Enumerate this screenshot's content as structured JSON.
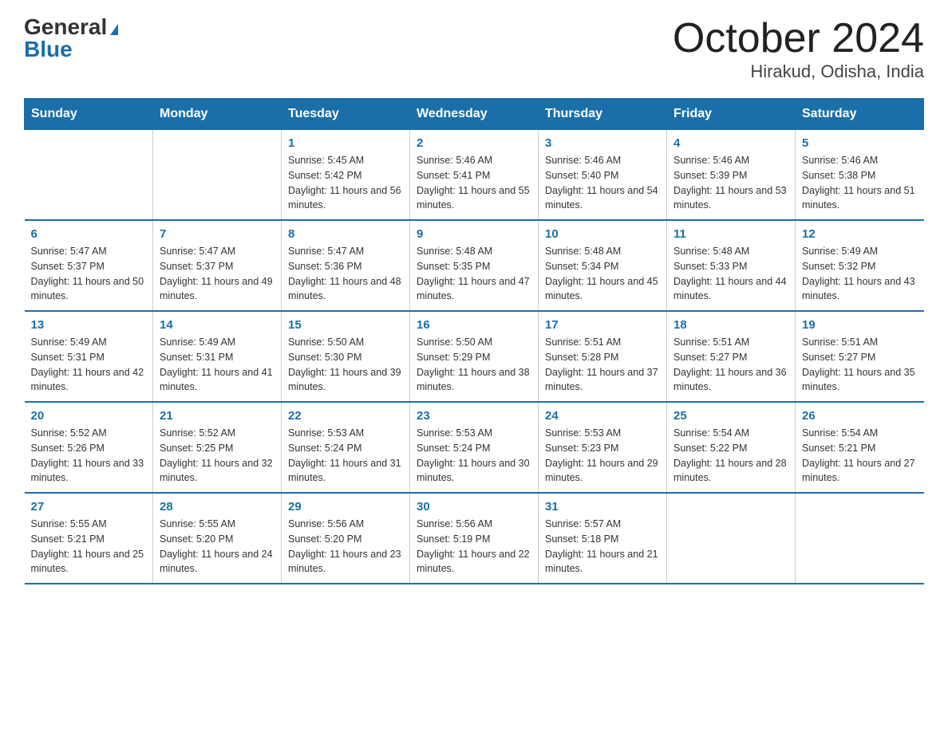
{
  "logo": {
    "general": "General",
    "blue": "Blue"
  },
  "title": "October 2024",
  "location": "Hirakud, Odisha, India",
  "days_of_week": [
    "Sunday",
    "Monday",
    "Tuesday",
    "Wednesday",
    "Thursday",
    "Friday",
    "Saturday"
  ],
  "weeks": [
    [
      {
        "day": "",
        "sunrise": "",
        "sunset": "",
        "daylight": ""
      },
      {
        "day": "",
        "sunrise": "",
        "sunset": "",
        "daylight": ""
      },
      {
        "day": "1",
        "sunrise": "Sunrise: 5:45 AM",
        "sunset": "Sunset: 5:42 PM",
        "daylight": "Daylight: 11 hours and 56 minutes."
      },
      {
        "day": "2",
        "sunrise": "Sunrise: 5:46 AM",
        "sunset": "Sunset: 5:41 PM",
        "daylight": "Daylight: 11 hours and 55 minutes."
      },
      {
        "day": "3",
        "sunrise": "Sunrise: 5:46 AM",
        "sunset": "Sunset: 5:40 PM",
        "daylight": "Daylight: 11 hours and 54 minutes."
      },
      {
        "day": "4",
        "sunrise": "Sunrise: 5:46 AM",
        "sunset": "Sunset: 5:39 PM",
        "daylight": "Daylight: 11 hours and 53 minutes."
      },
      {
        "day": "5",
        "sunrise": "Sunrise: 5:46 AM",
        "sunset": "Sunset: 5:38 PM",
        "daylight": "Daylight: 11 hours and 51 minutes."
      }
    ],
    [
      {
        "day": "6",
        "sunrise": "Sunrise: 5:47 AM",
        "sunset": "Sunset: 5:37 PM",
        "daylight": "Daylight: 11 hours and 50 minutes."
      },
      {
        "day": "7",
        "sunrise": "Sunrise: 5:47 AM",
        "sunset": "Sunset: 5:37 PM",
        "daylight": "Daylight: 11 hours and 49 minutes."
      },
      {
        "day": "8",
        "sunrise": "Sunrise: 5:47 AM",
        "sunset": "Sunset: 5:36 PM",
        "daylight": "Daylight: 11 hours and 48 minutes."
      },
      {
        "day": "9",
        "sunrise": "Sunrise: 5:48 AM",
        "sunset": "Sunset: 5:35 PM",
        "daylight": "Daylight: 11 hours and 47 minutes."
      },
      {
        "day": "10",
        "sunrise": "Sunrise: 5:48 AM",
        "sunset": "Sunset: 5:34 PM",
        "daylight": "Daylight: 11 hours and 45 minutes."
      },
      {
        "day": "11",
        "sunrise": "Sunrise: 5:48 AM",
        "sunset": "Sunset: 5:33 PM",
        "daylight": "Daylight: 11 hours and 44 minutes."
      },
      {
        "day": "12",
        "sunrise": "Sunrise: 5:49 AM",
        "sunset": "Sunset: 5:32 PM",
        "daylight": "Daylight: 11 hours and 43 minutes."
      }
    ],
    [
      {
        "day": "13",
        "sunrise": "Sunrise: 5:49 AM",
        "sunset": "Sunset: 5:31 PM",
        "daylight": "Daylight: 11 hours and 42 minutes."
      },
      {
        "day": "14",
        "sunrise": "Sunrise: 5:49 AM",
        "sunset": "Sunset: 5:31 PM",
        "daylight": "Daylight: 11 hours and 41 minutes."
      },
      {
        "day": "15",
        "sunrise": "Sunrise: 5:50 AM",
        "sunset": "Sunset: 5:30 PM",
        "daylight": "Daylight: 11 hours and 39 minutes."
      },
      {
        "day": "16",
        "sunrise": "Sunrise: 5:50 AM",
        "sunset": "Sunset: 5:29 PM",
        "daylight": "Daylight: 11 hours and 38 minutes."
      },
      {
        "day": "17",
        "sunrise": "Sunrise: 5:51 AM",
        "sunset": "Sunset: 5:28 PM",
        "daylight": "Daylight: 11 hours and 37 minutes."
      },
      {
        "day": "18",
        "sunrise": "Sunrise: 5:51 AM",
        "sunset": "Sunset: 5:27 PM",
        "daylight": "Daylight: 11 hours and 36 minutes."
      },
      {
        "day": "19",
        "sunrise": "Sunrise: 5:51 AM",
        "sunset": "Sunset: 5:27 PM",
        "daylight": "Daylight: 11 hours and 35 minutes."
      }
    ],
    [
      {
        "day": "20",
        "sunrise": "Sunrise: 5:52 AM",
        "sunset": "Sunset: 5:26 PM",
        "daylight": "Daylight: 11 hours and 33 minutes."
      },
      {
        "day": "21",
        "sunrise": "Sunrise: 5:52 AM",
        "sunset": "Sunset: 5:25 PM",
        "daylight": "Daylight: 11 hours and 32 minutes."
      },
      {
        "day": "22",
        "sunrise": "Sunrise: 5:53 AM",
        "sunset": "Sunset: 5:24 PM",
        "daylight": "Daylight: 11 hours and 31 minutes."
      },
      {
        "day": "23",
        "sunrise": "Sunrise: 5:53 AM",
        "sunset": "Sunset: 5:24 PM",
        "daylight": "Daylight: 11 hours and 30 minutes."
      },
      {
        "day": "24",
        "sunrise": "Sunrise: 5:53 AM",
        "sunset": "Sunset: 5:23 PM",
        "daylight": "Daylight: 11 hours and 29 minutes."
      },
      {
        "day": "25",
        "sunrise": "Sunrise: 5:54 AM",
        "sunset": "Sunset: 5:22 PM",
        "daylight": "Daylight: 11 hours and 28 minutes."
      },
      {
        "day": "26",
        "sunrise": "Sunrise: 5:54 AM",
        "sunset": "Sunset: 5:21 PM",
        "daylight": "Daylight: 11 hours and 27 minutes."
      }
    ],
    [
      {
        "day": "27",
        "sunrise": "Sunrise: 5:55 AM",
        "sunset": "Sunset: 5:21 PM",
        "daylight": "Daylight: 11 hours and 25 minutes."
      },
      {
        "day": "28",
        "sunrise": "Sunrise: 5:55 AM",
        "sunset": "Sunset: 5:20 PM",
        "daylight": "Daylight: 11 hours and 24 minutes."
      },
      {
        "day": "29",
        "sunrise": "Sunrise: 5:56 AM",
        "sunset": "Sunset: 5:20 PM",
        "daylight": "Daylight: 11 hours and 23 minutes."
      },
      {
        "day": "30",
        "sunrise": "Sunrise: 5:56 AM",
        "sunset": "Sunset: 5:19 PM",
        "daylight": "Daylight: 11 hours and 22 minutes."
      },
      {
        "day": "31",
        "sunrise": "Sunrise: 5:57 AM",
        "sunset": "Sunset: 5:18 PM",
        "daylight": "Daylight: 11 hours and 21 minutes."
      },
      {
        "day": "",
        "sunrise": "",
        "sunset": "",
        "daylight": ""
      },
      {
        "day": "",
        "sunrise": "",
        "sunset": "",
        "daylight": ""
      }
    ]
  ]
}
